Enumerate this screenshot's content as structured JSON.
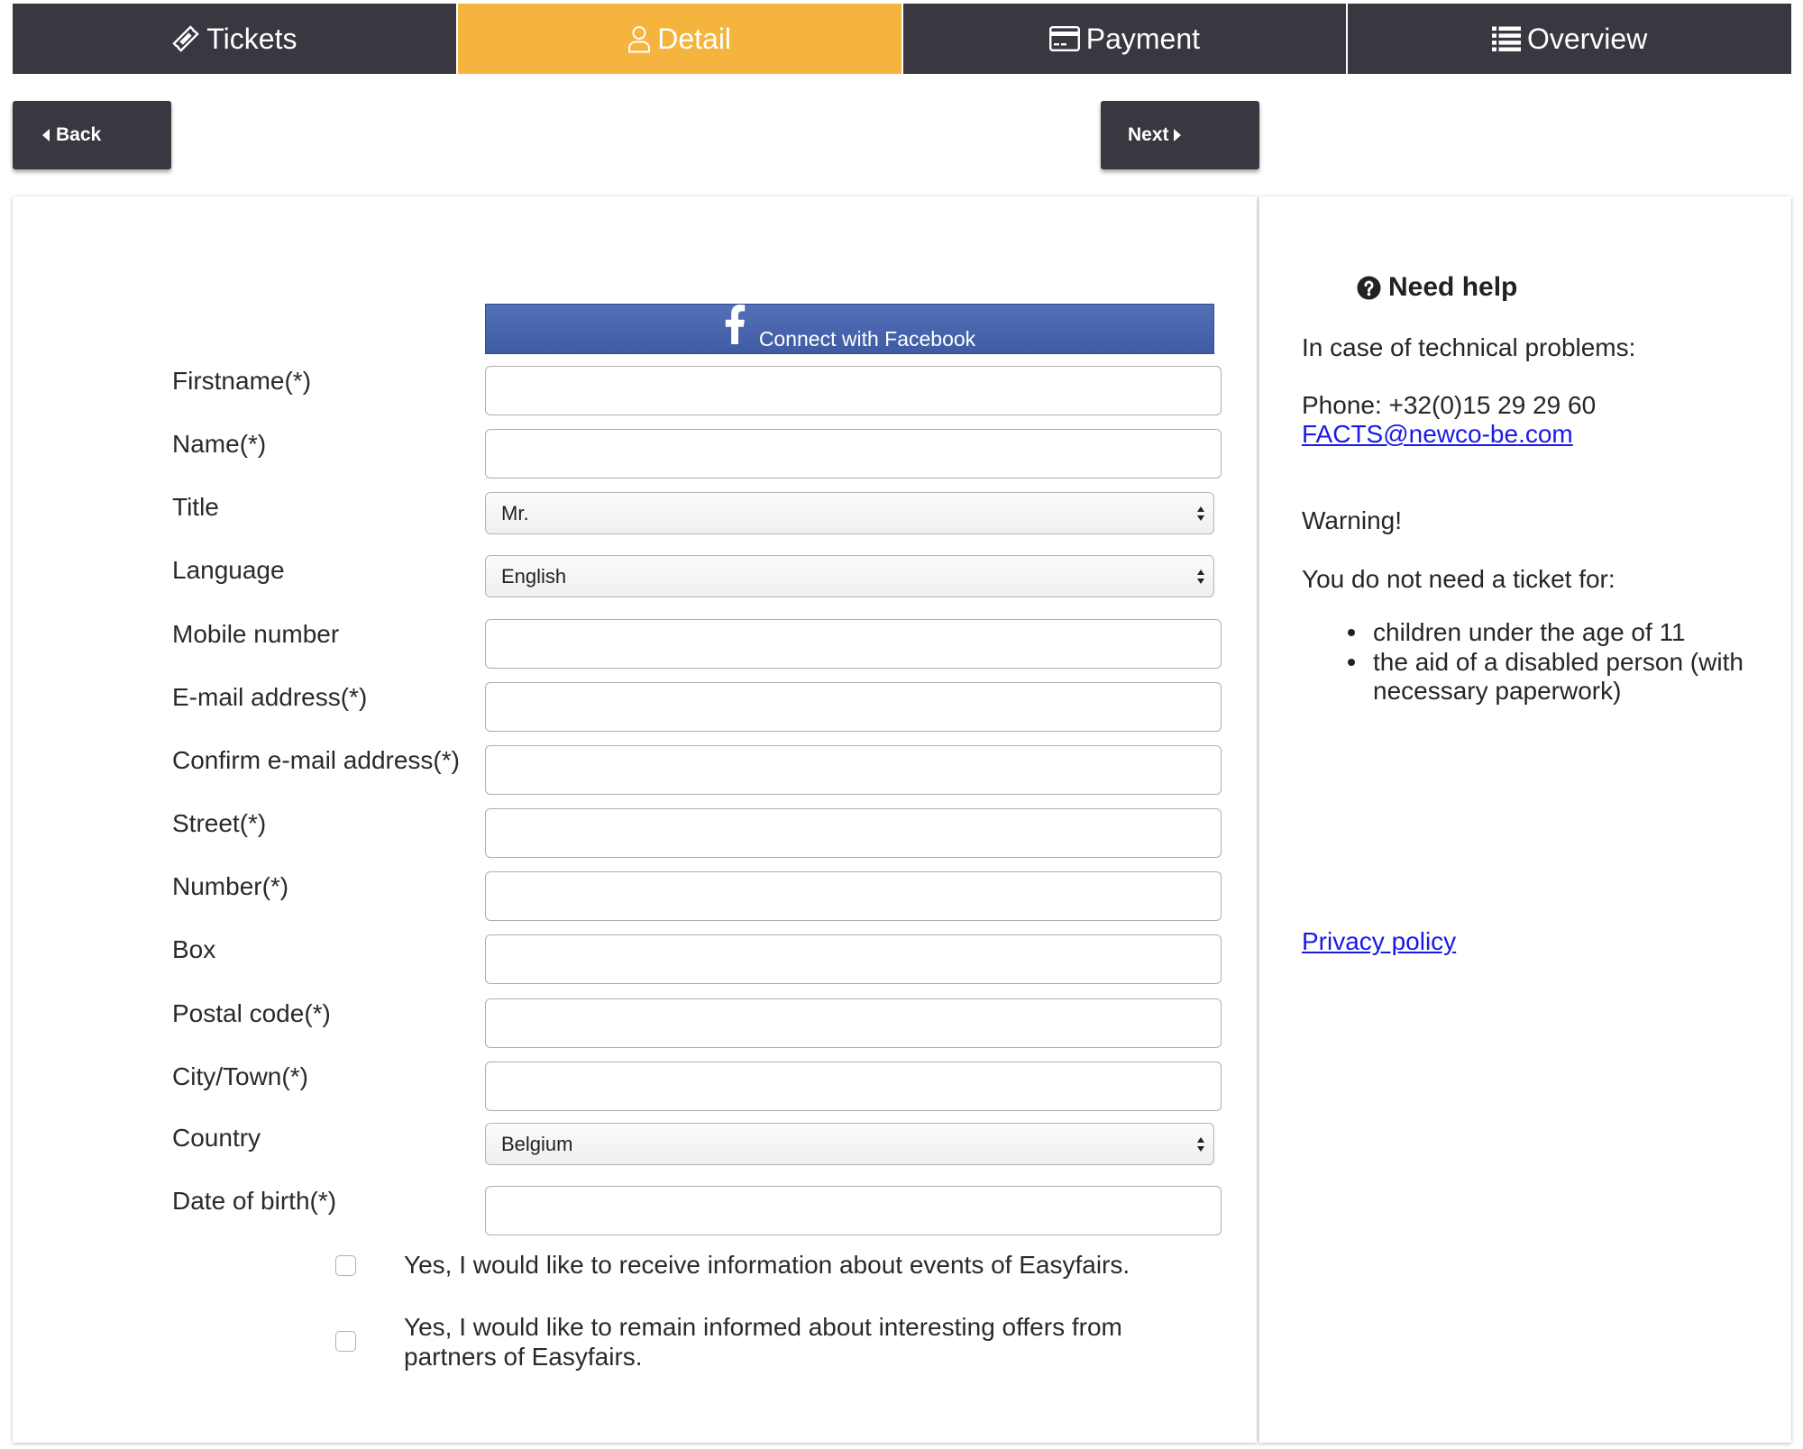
{
  "tabs": [
    {
      "label": "Tickets",
      "icon": "ticket-icon",
      "active": false
    },
    {
      "label": "Detail",
      "icon": "user-icon",
      "active": true
    },
    {
      "label": "Payment",
      "icon": "credit-card-icon",
      "active": false
    },
    {
      "label": "Overview",
      "icon": "list-icon",
      "active": false
    }
  ],
  "nav": {
    "back_label": "Back",
    "back_icon": "caret-left-icon",
    "next_label": "Next",
    "next_icon": "caret-right-icon"
  },
  "facebook": {
    "label": "Connect with Facebook",
    "icon": "facebook-icon"
  },
  "form": {
    "fields": [
      {
        "label": "Firstname(*)",
        "value": ""
      },
      {
        "label": "Name(*)",
        "value": ""
      },
      {
        "label": "Title",
        "value": "Mr."
      },
      {
        "label": "Language",
        "value": "English"
      },
      {
        "label": "Mobile number",
        "value": ""
      },
      {
        "label": "E-mail address(*)",
        "value": ""
      },
      {
        "label": "Confirm e-mail address(*)",
        "value": ""
      },
      {
        "label": "Street(*)",
        "value": ""
      },
      {
        "label": "Number(*)",
        "value": ""
      },
      {
        "label": "Box",
        "value": ""
      },
      {
        "label": "Postal code(*)",
        "value": ""
      },
      {
        "label": "City/Town(*)",
        "value": ""
      },
      {
        "label": "Country",
        "value": "Belgium"
      },
      {
        "label": "Date of birth(*)",
        "value": ""
      }
    ]
  },
  "consents": [
    {
      "label": "Yes, I would like to receive information about events of Easyfairs.",
      "checked": false
    },
    {
      "label": "Yes, I would like to remain informed about interesting offers from partners of Easyfairs.",
      "checked": false
    }
  ],
  "help": {
    "title": "Need help",
    "icon": "question-circle-icon",
    "intro": "In case of technical problems:",
    "phone": "Phone: +32(0)15 29 29 60",
    "email": "FACTS@newco-be.com",
    "warning": "Warning!",
    "no_ticket_intro": "You do not need a ticket for:",
    "no_ticket_items": [
      "children under the age of 11",
      "the aid of a disabled person (with necessary paperwork)"
    ],
    "privacy_link": "Privacy policy"
  },
  "colors": {
    "tab-bg": "#3a3741",
    "tab-active": "#f5b43d",
    "facebook": "#4463b1",
    "link": "#1a1ae6"
  }
}
